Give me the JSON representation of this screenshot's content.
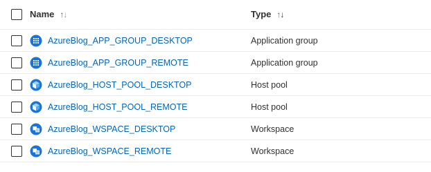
{
  "header": {
    "name_label": "Name",
    "type_label": "Type",
    "sort_up": "↑",
    "sort_down": "↓"
  },
  "rows": [
    {
      "name": "AzureBlog_APP_GROUP_DESKTOP",
      "type": "Application group",
      "icon": "application-group-icon"
    },
    {
      "name": "AzureBlog_APP_GROUP_REMOTE",
      "type": "Application group",
      "icon": "application-group-icon"
    },
    {
      "name": "AzureBlog_HOST_POOL_DESKTOP",
      "type": "Host pool",
      "icon": "host-pool-icon"
    },
    {
      "name": "AzureBlog_HOST_POOL_REMOTE",
      "type": "Host pool",
      "icon": "host-pool-icon"
    },
    {
      "name": "AzureBlog_WSPACE_DESKTOP",
      "type": "Workspace",
      "icon": "workspace-icon"
    },
    {
      "name": "AzureBlog_WSPACE_REMOTE",
      "type": "Workspace",
      "icon": "workspace-icon"
    }
  ],
  "colors": {
    "link": "#0066b8",
    "text": "#323130",
    "icon_blue": "#1a73d9",
    "divider": "#edebe9"
  }
}
